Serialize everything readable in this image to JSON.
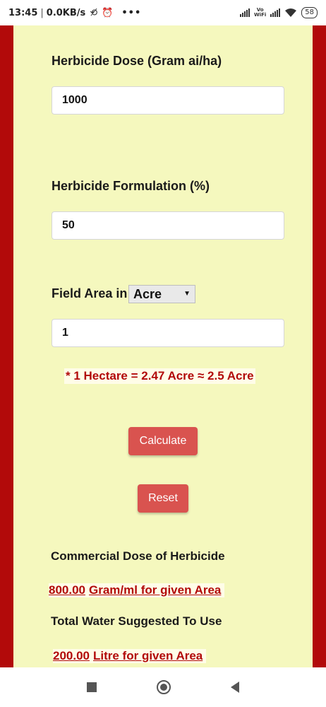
{
  "status_bar": {
    "time": "13:45",
    "separator": "|",
    "speed": "0.0KB/s",
    "dots": "•••",
    "vo": "Vo",
    "wifi_label": "WiFi",
    "battery": "58"
  },
  "form": {
    "dose_label": "Herbicide Dose (Gram ai/ha)",
    "dose_value": "1000",
    "formulation_label": "Herbicide Formulation (%)",
    "formulation_value": "50",
    "area_label": "Field Area in",
    "area_unit_selected": "Acre",
    "area_value": "1",
    "conversion_note": "* 1 Hectare = 2.47 Acre ≈ 2.5 Acre",
    "calculate_label": "Calculate",
    "reset_label": "Reset"
  },
  "results": {
    "commercial_dose_label": "Commercial Dose of Herbicide",
    "commercial_dose_value": "800.00",
    "commercial_dose_unit": "Gram/ml for given Area",
    "water_label": "Total Water Suggested To Use",
    "water_value": "200.00",
    "water_unit": "Litre for given Area"
  },
  "colors": {
    "page_background": "#b20a0a",
    "card_background": "#f5f8be",
    "button": "#d9534f",
    "result_text": "#b20a0a"
  },
  "icons": {
    "status": [
      "no-sync-icon",
      "alarm-icon",
      "signal-icon",
      "wifi-icon",
      "battery-icon"
    ],
    "nav": [
      "recent-apps-icon",
      "home-icon",
      "back-icon"
    ]
  }
}
